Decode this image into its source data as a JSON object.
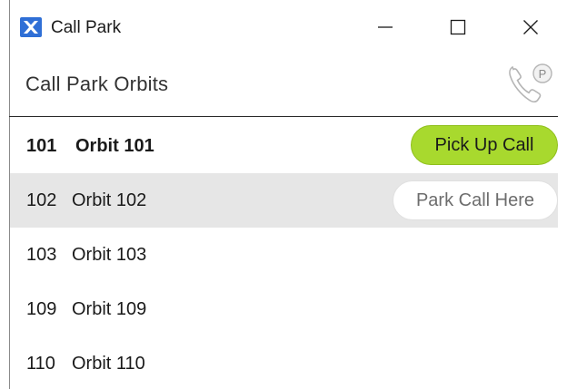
{
  "window": {
    "title": "Call Park",
    "app_icon": "call-park-app-icon",
    "controls": {
      "minimize": "minimize-icon",
      "maximize": "maximize-icon",
      "close": "close-icon"
    }
  },
  "header": {
    "title": "Call Park Orbits",
    "icon": "phone-park-icon",
    "icon_badge": "P"
  },
  "orbits": [
    {
      "number": "101",
      "name": "Orbit 101",
      "state": "active",
      "action_label": "Pick Up Call"
    },
    {
      "number": "102",
      "name": "Orbit 102",
      "state": "hover",
      "action_label": "Park Call Here"
    },
    {
      "number": "103",
      "name": "Orbit 103",
      "state": "idle"
    },
    {
      "number": "109",
      "name": "Orbit 109",
      "state": "idle"
    },
    {
      "number": "110",
      "name": "Orbit 110",
      "state": "idle"
    }
  ],
  "colors": {
    "pickup_button": "#a8d92e",
    "hover_row": "#e6e6e6",
    "app_icon_blue": "#2f6fd6"
  }
}
